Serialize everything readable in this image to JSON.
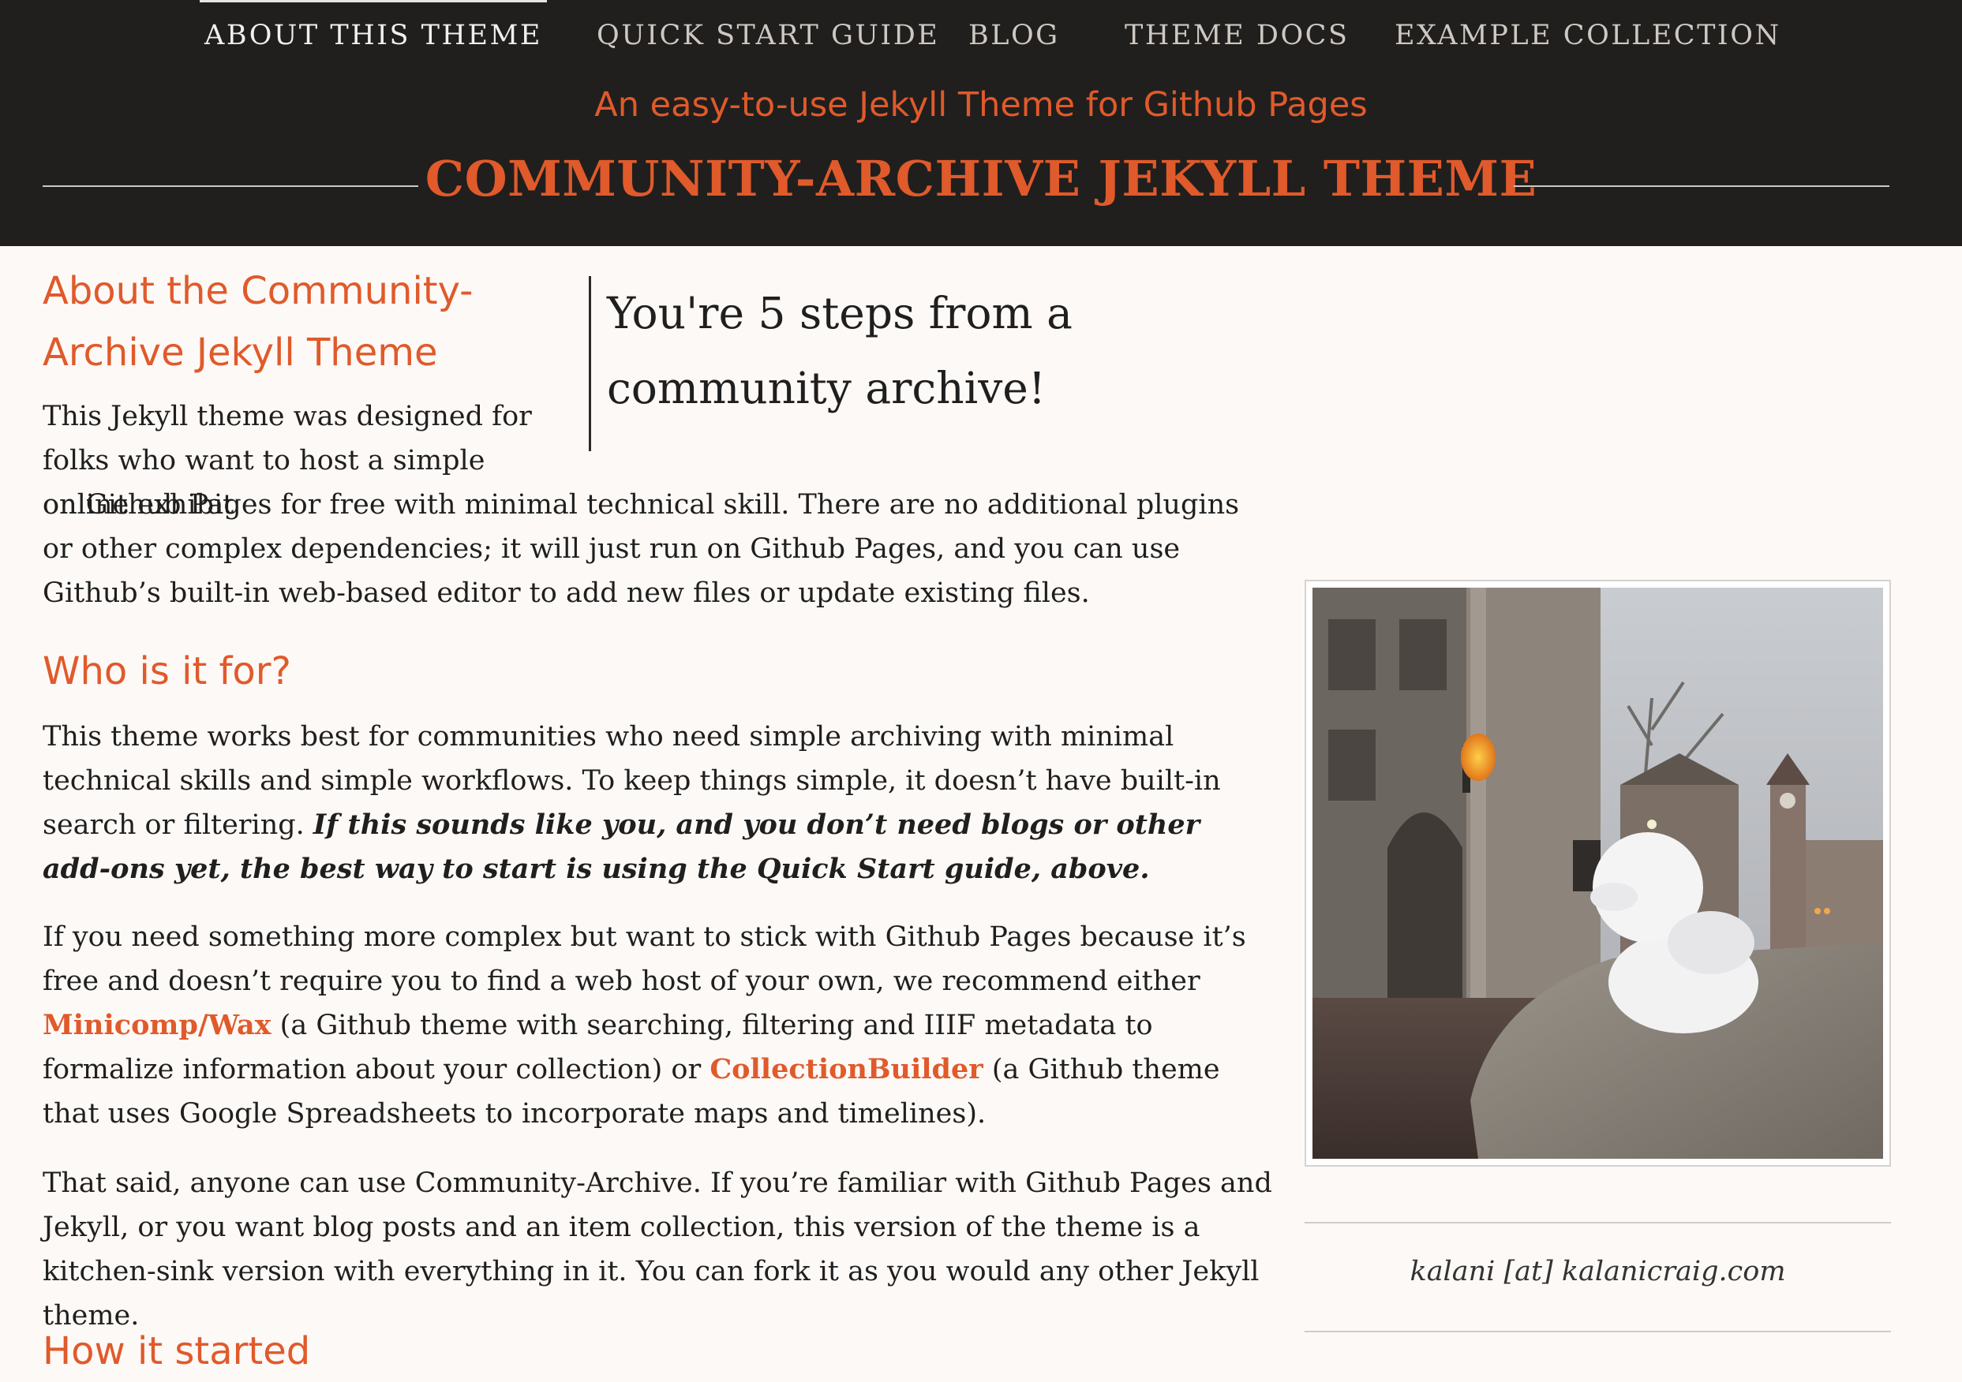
{
  "nav": {
    "items": [
      {
        "label": "About this theme"
      },
      {
        "label": "Quick Start Guide"
      },
      {
        "label": "Blog"
      },
      {
        "label": "Theme Docs"
      },
      {
        "label": "Example Collection"
      }
    ]
  },
  "header": {
    "tagline": "An easy-to-use Jekyll Theme for Github Pages",
    "title": "COMMUNITY-ARCHIVE JEKYLL THEME"
  },
  "content": {
    "about_heading": "About the Community-Archive Jekyll Theme",
    "pullquote": "You're 5 steps from a community archive!",
    "p1_start": "This Jekyll theme was designed for folks who want to host a simple online exhibit",
    "p1_rest": "on Github Pages for free with minimal technical skill. There are no additional plugins or other complex dependencies; it will just run on Github Pages, and you can use Github’s built-in web-based editor to add new files or update existing files.",
    "who_heading": "Who is it for?",
    "p2_text": "This theme works best for communities who need simple archiving with minimal technical skills and simple workflows. To keep things simple, it doesn’t have built-in search or filtering. ",
    "p2_emph": "If this sounds like you, and you don’t need blogs or other add-ons yet, the best way to start is using the Quick Start guide, above.",
    "p3_a": "If you need something more complex but want to stick with Github Pages because it’s free and doesn’t require you to find a web host of your own, we recommend either ",
    "p3_link1": "Minicomp/Wax",
    "p3_b": " (a Github theme with searching, filtering and IIIF metadata to formalize information about your collection) or ",
    "p3_link2": "CollectionBuilder",
    "p3_c": " (a Github theme that uses Google Spreadsheets to incorporate maps and timelines).",
    "p4": "That said, anyone can use Community-Archive. If you’re familiar with Github Pages and Jekyll, or you want blog posts and an item collection, this version of the theme is a kitchen-sink version with everything in it. You can fork it as you would any other Jekyll theme.",
    "how_heading": "How it started"
  },
  "sidebar": {
    "contact": "kalani [at] kalanicraig.com"
  },
  "colors": {
    "accent": "#e05a2b",
    "header_bg": "#201f1d",
    "page_bg": "#fdf9f6"
  }
}
